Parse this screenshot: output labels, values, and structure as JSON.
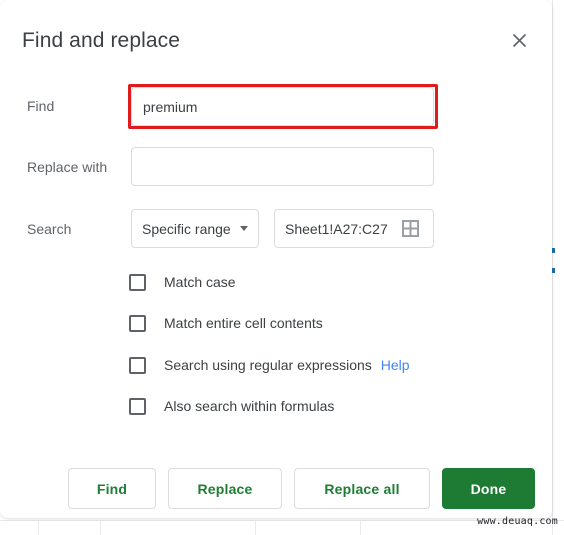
{
  "dialog": {
    "title": "Find and replace",
    "close_icon": "close-icon"
  },
  "find": {
    "label": "Find",
    "value": "premium",
    "placeholder": ""
  },
  "replace": {
    "label": "Replace with",
    "value": "",
    "placeholder": ""
  },
  "search": {
    "label": "Search",
    "scope_selected": "Specific range",
    "scope_caret_icon": "chevron-down-icon",
    "range_value": "Sheet1!A27:C27",
    "range_picker_icon": "grid-icon"
  },
  "options": [
    {
      "label": "Match case",
      "checked": false
    },
    {
      "label": "Match entire cell contents",
      "checked": false
    },
    {
      "label": "Search using regular expressions",
      "checked": false,
      "help_label": "Help"
    },
    {
      "label": "Also search within formulas",
      "checked": false
    }
  ],
  "footer": {
    "find_label": "Find",
    "replace_label": "Replace",
    "replace_all_label": "Replace all",
    "done_label": "Done"
  },
  "watermark": "www.deuaq.com",
  "colors": {
    "accent_green": "#1e7b34",
    "button_text_green": "#1e7e34",
    "link_blue": "#4285f4",
    "annotation_red": "#e01b1b",
    "label_gray": "#5f6368",
    "border_gray": "#dadce0"
  }
}
